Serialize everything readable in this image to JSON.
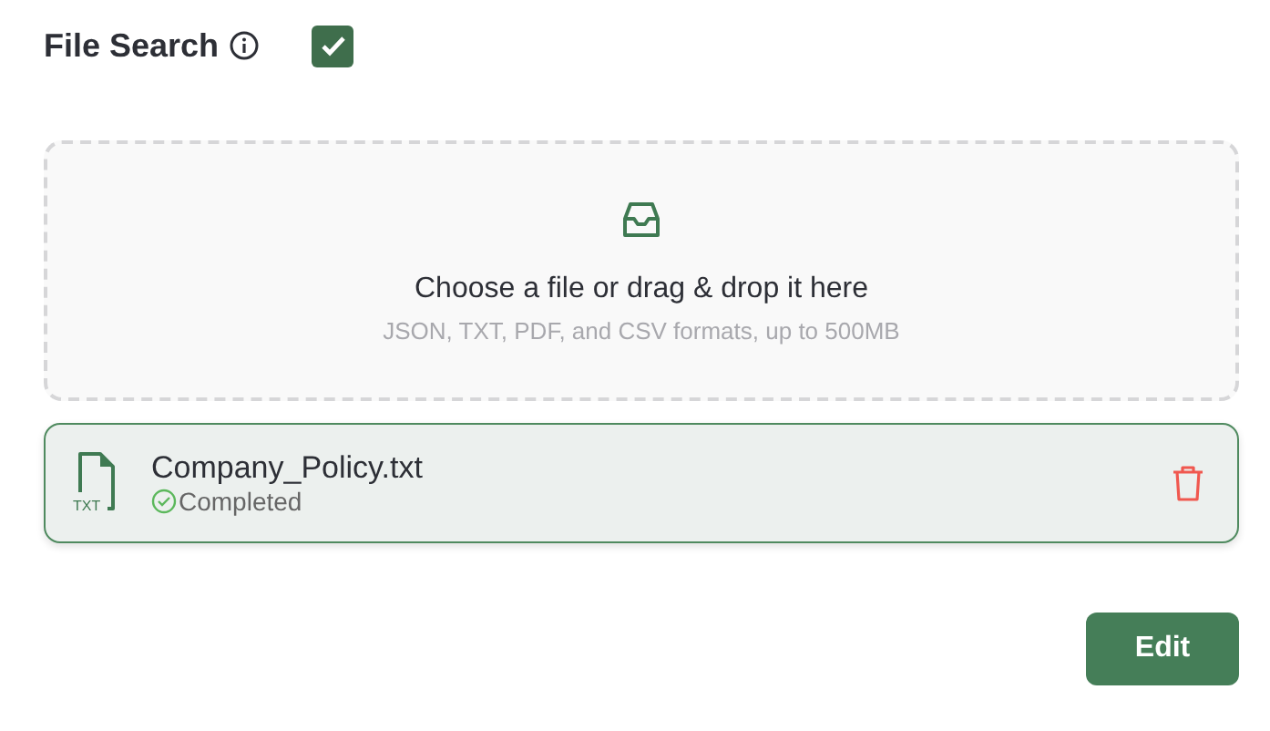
{
  "header": {
    "title": "File Search",
    "enabled": true
  },
  "dropzone": {
    "prompt": "Choose a file or drag & drop it here",
    "hint": "JSON, TXT, PDF, and CSV formats, up to 500MB"
  },
  "files": [
    {
      "type_label": "TXT",
      "name": "Company_Policy.txt",
      "status": "Completed"
    }
  ],
  "buttons": [
    "Edit"
  ]
}
